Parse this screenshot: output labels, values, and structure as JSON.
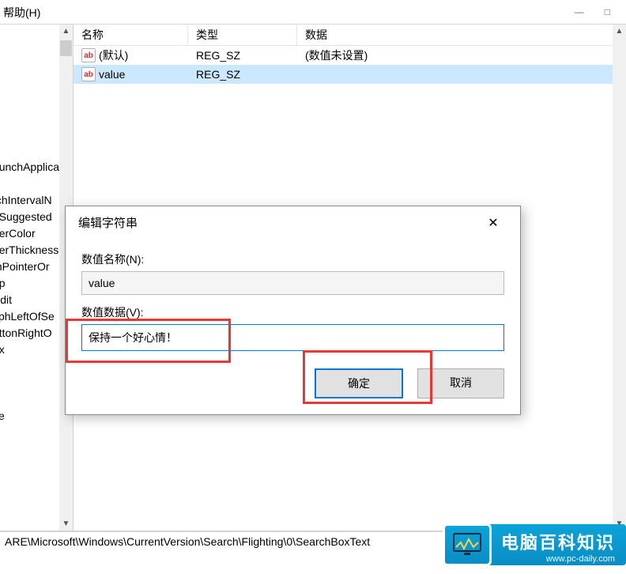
{
  "menubar": {
    "help": "帮助(H)"
  },
  "window_controls": {
    "minimize": "—",
    "maximize": "□"
  },
  "tree": {
    "items": [
      "aunchApplica",
      "",
      "tchIntervalN",
      "oSuggested",
      "derColor",
      "derThickness",
      "mPointerOr",
      "op",
      "Edit",
      "yphLeftOfSe",
      "uttonRightO",
      "ox",
      "",
      "",
      "",
      "ce",
      ""
    ]
  },
  "listview": {
    "headers": {
      "name": "名称",
      "type": "类型",
      "data": "数据"
    },
    "rows": [
      {
        "name": "(默认)",
        "type": "REG_SZ",
        "data": "(数值未设置)",
        "selected": false
      },
      {
        "name": "value",
        "type": "REG_SZ",
        "data": "",
        "selected": true
      }
    ]
  },
  "dialog": {
    "title": "编辑字符串",
    "name_label": "数值名称(N):",
    "name_value": "value",
    "data_label": "数值数据(V):",
    "data_value": "保持一个好心情！",
    "ok": "确定",
    "cancel": "取消"
  },
  "statusbar": {
    "path": "ARE\\Microsoft\\Windows\\CurrentVersion\\Search\\Flighting\\0\\SearchBoxText"
  },
  "watermark": {
    "title": "电脑百科知识",
    "url": "www.pc-daily.com"
  }
}
